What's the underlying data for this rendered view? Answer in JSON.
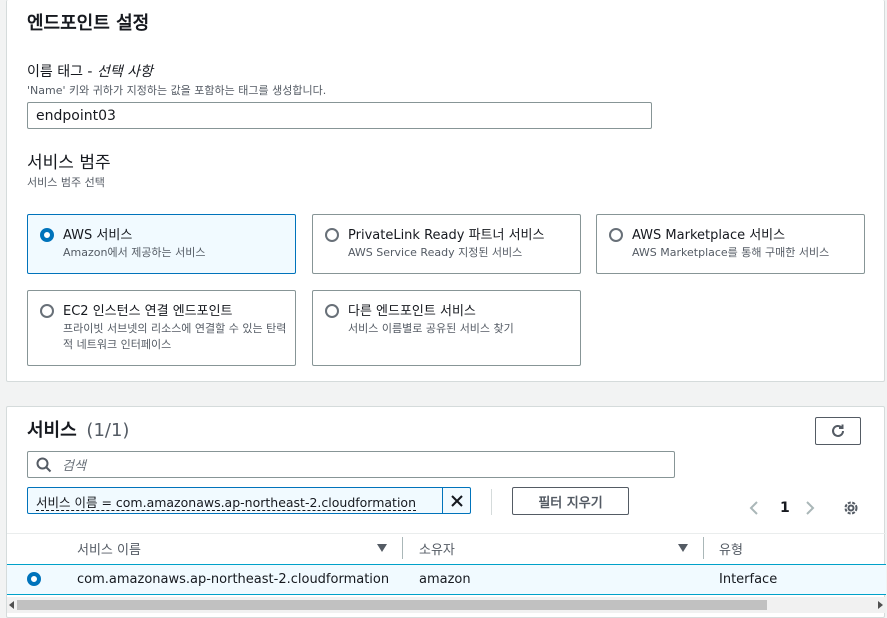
{
  "section1": {
    "title": "엔드포인트 설정",
    "name_tag": {
      "label": "이름 태그 - ",
      "optional": "선택 사항",
      "description": "'Name' 키와 귀하가 지정하는 값을 포함하는 태그를 생성합니다.",
      "value": "endpoint03"
    },
    "service_category": {
      "title": "서비스 범주",
      "description": "서비스 범주 선택",
      "options": [
        {
          "title": "AWS 서비스",
          "description": "Amazon에서 제공하는 서비스",
          "selected": true
        },
        {
          "title": "PrivateLink Ready 파트너 서비스",
          "description": "AWS Service Ready 지정된 서비스",
          "selected": false
        },
        {
          "title": "AWS Marketplace 서비스",
          "description": "AWS Marketplace를 통해 구매한 서비스",
          "selected": false
        },
        {
          "title": "EC2 인스턴스 연결 엔드포인트",
          "description": "프라이빗 서브넷의 리소스에 연결할 수 있는 탄력적 네트워크 인터페이스",
          "selected": false
        },
        {
          "title": "다른 엔드포인트 서비스",
          "description": "서비스 이름별로 공유된 서비스 찾기",
          "selected": false
        }
      ]
    }
  },
  "section2": {
    "title": "서비스",
    "count": "(1/1)",
    "search_placeholder": "검색",
    "filter_token": "서비스 이름 = com.amazonaws.ap-northeast-2.cloudformation",
    "clear_filters_label": "필터 지우기",
    "pagination": {
      "current_page": "1"
    },
    "columns": [
      "서비스 이름",
      "소유자",
      "유형"
    ],
    "rows": [
      {
        "service_name": "com.amazonaws.ap-northeast-2.cloudformation",
        "owner": "amazon",
        "type": "Interface",
        "selected": true
      }
    ]
  },
  "colors": {
    "accent": "#0073bb",
    "selected_bg": "#f1faff",
    "border": "#879596"
  }
}
